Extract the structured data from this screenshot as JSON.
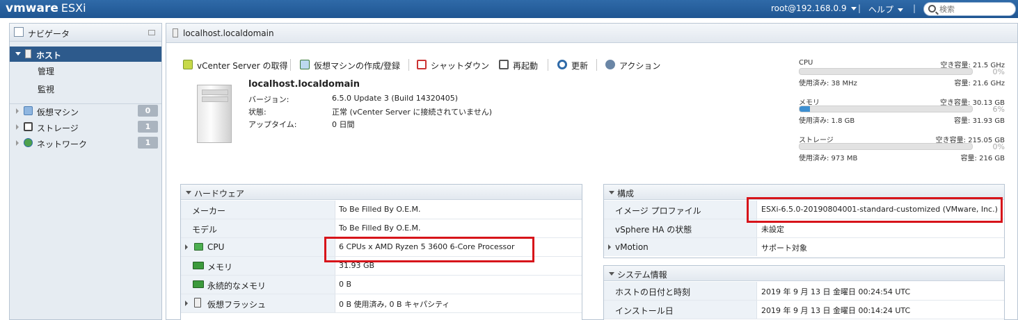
{
  "topbar": {
    "brand_vm": "vmware",
    "brand_esxi": "ESXi",
    "user": "root@192.168.0.9",
    "help": "ヘルプ",
    "search_placeholder": "検索"
  },
  "navigator": {
    "title": "ナビゲータ",
    "host": "ホスト",
    "sub_items": [
      "管理",
      "監視"
    ],
    "items": [
      {
        "label": "仮想マシン",
        "count": "0"
      },
      {
        "label": "ストレージ",
        "count": "1"
      },
      {
        "label": "ネットワーク",
        "count": "1"
      }
    ]
  },
  "main": {
    "title": "localhost.localdomain",
    "toolbar": [
      {
        "label": "vCenter Server の取得",
        "icon": "vcenter-icon"
      },
      {
        "label": "仮想マシンの作成/登録",
        "icon": "create-vm-icon"
      },
      {
        "label": "シャットダウン",
        "icon": "shutdown-icon"
      },
      {
        "label": "再起動",
        "icon": "reboot-icon"
      },
      {
        "label": "更新",
        "icon": "refresh-icon"
      },
      {
        "label": "アクション",
        "icon": "gear-icon"
      }
    ],
    "host_name": "localhost.localdomain",
    "info": [
      {
        "label": "バージョン:",
        "value": "6.5.0 Update 3 (Build 14320405)"
      },
      {
        "label": "状態:",
        "value": "正常 (vCenter Server に接続されていません)"
      },
      {
        "label": "アップタイム:",
        "value": "0 日間"
      }
    ]
  },
  "resources": [
    {
      "name": "CPU",
      "free": "空き容量: 21.5 GHz",
      "percent": 0,
      "percent_label": "0%",
      "used": "使用済み: 38 MHz",
      "capacity": "容量: 21.6 GHz"
    },
    {
      "name": "メモリ",
      "free": "空き容量: 30.13 GB",
      "percent": 6,
      "percent_label": "6%",
      "used": "使用済み: 1.8 GB",
      "capacity": "容量: 31.93 GB"
    },
    {
      "name": "ストレージ",
      "free": "空き容量: 215.05 GB",
      "percent": 0,
      "percent_label": "0%",
      "used": "使用済み: 973 MB",
      "capacity": "容量: 216 GB"
    }
  ],
  "hardware": {
    "title": "ハードウェア",
    "rows": [
      {
        "label": "メーカー",
        "value": "To Be Filled By O.E.M."
      },
      {
        "label": "モデル",
        "value": "To Be Filled By O.E.M."
      },
      {
        "label": "CPU",
        "value": "6 CPUs x AMD Ryzen 5 3600 6-Core Processor"
      },
      {
        "label": "メモリ",
        "value": "31.93 GB"
      },
      {
        "label": "永続的なメモリ",
        "value": "0 B"
      },
      {
        "label": "仮想フラッシュ",
        "value": "0 B 使用済み, 0 B キャパシティ"
      }
    ]
  },
  "config": {
    "title": "構成",
    "rows": [
      {
        "label": "イメージ プロファイル",
        "value": "ESXi-6.5.0-20190804001-standard-customized (VMware, Inc.)"
      },
      {
        "label": "vSphere HA の状態",
        "value": "未設定"
      },
      {
        "label": "vMotion",
        "value": "サポート対象"
      }
    ]
  },
  "system": {
    "title": "システム情報",
    "rows": [
      {
        "label": "ホストの日付と時刻",
        "value": "2019 年 9 月 13 日 金曜日 00:24:54 UTC"
      },
      {
        "label": "インストール日",
        "value": "2019 年 9 月 13 日 金曜日 00:14:24 UTC"
      }
    ]
  },
  "colors": {
    "accent": "#2d5a8c",
    "highlight": "#d7141a",
    "bar_fill": "#3d8fd1"
  }
}
